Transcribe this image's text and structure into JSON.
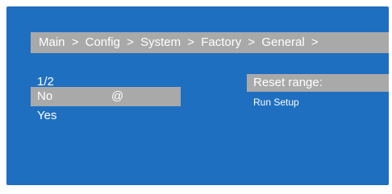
{
  "breadcrumb": {
    "items": [
      "Main",
      "Config",
      "System",
      "Factory",
      "General"
    ],
    "separator": ">"
  },
  "list": {
    "page_indicator": "1/2",
    "options": [
      {
        "label": "No",
        "marker": "@",
        "selected": true
      },
      {
        "label": "Yes",
        "marker": "",
        "selected": false
      }
    ]
  },
  "side_panel": {
    "title": "Reset range:",
    "item": "Run Setup"
  },
  "colors": {
    "background": "#1f6fc1",
    "highlight": "#a9a9a9",
    "text": "#ffffff"
  }
}
